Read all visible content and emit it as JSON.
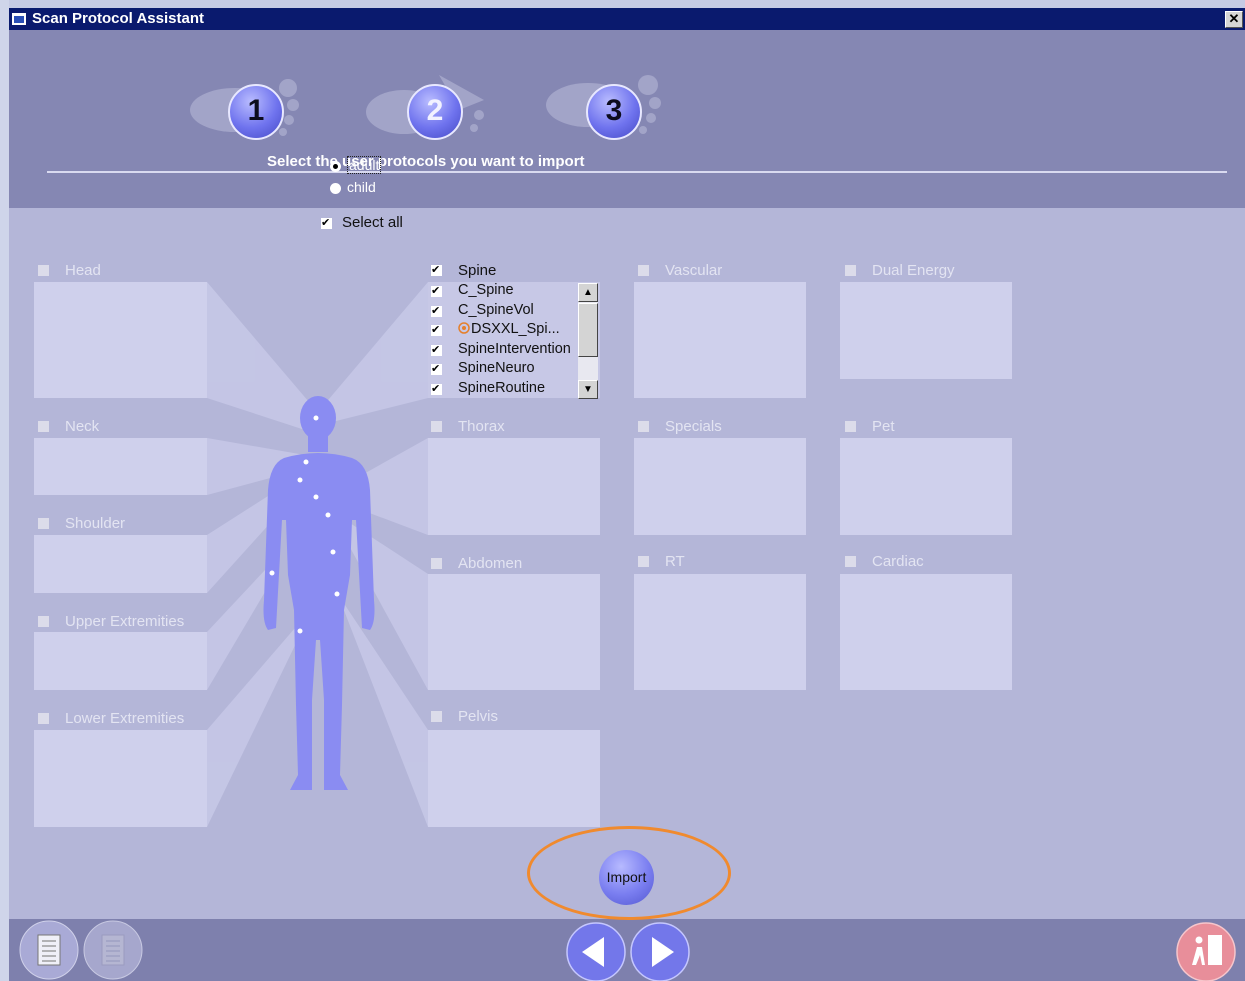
{
  "window": {
    "title": "Scan Protocol Assistant",
    "close_label": "✕"
  },
  "steps": [
    "1",
    "2",
    "3"
  ],
  "instruction": "Select the user protocols you want to import",
  "age_options": [
    {
      "label": "adult",
      "selected": true
    },
    {
      "label": "child",
      "selected": false
    }
  ],
  "select_all": {
    "label": "Select all",
    "checked": true
  },
  "categories": {
    "head": "Head",
    "neck": "Neck",
    "shoulder": "Shoulder",
    "upper": "Upper Extremities",
    "lower": "Lower Extremities",
    "spine": "Spine",
    "thorax": "Thorax",
    "abdomen": "Abdomen",
    "pelvis": "Pelvis",
    "vascular": "Vascular",
    "specials": "Specials",
    "rt": "RT",
    "dual": "Dual Energy",
    "pet": "Pet",
    "cardiac": "Cardiac"
  },
  "spine_items": [
    {
      "label": "C_Spine",
      "checked": true
    },
    {
      "label": "C_SpineVol",
      "checked": true
    },
    {
      "label": "DSXXL_Spi...",
      "checked": true,
      "icon": "syngo-icon"
    },
    {
      "label": "SpineIntervention",
      "checked": true
    },
    {
      "label": "SpineNeuro",
      "checked": true
    },
    {
      "label": "SpineRoutine",
      "checked": true
    }
  ],
  "import_label": "Import",
  "footer": {
    "left_buttons": [
      "document-icon",
      "document-disabled-icon"
    ],
    "nav": [
      "back-arrow-icon",
      "forward-arrow-icon"
    ],
    "right_button": "patient-exit-icon"
  },
  "colors": {
    "titlebar": "#0a1a6e",
    "header_bg": "#8587b3",
    "content_bg": "#b4b6d8",
    "accent_circle": "#f08a2e",
    "step_blue": "#6f73ee"
  }
}
